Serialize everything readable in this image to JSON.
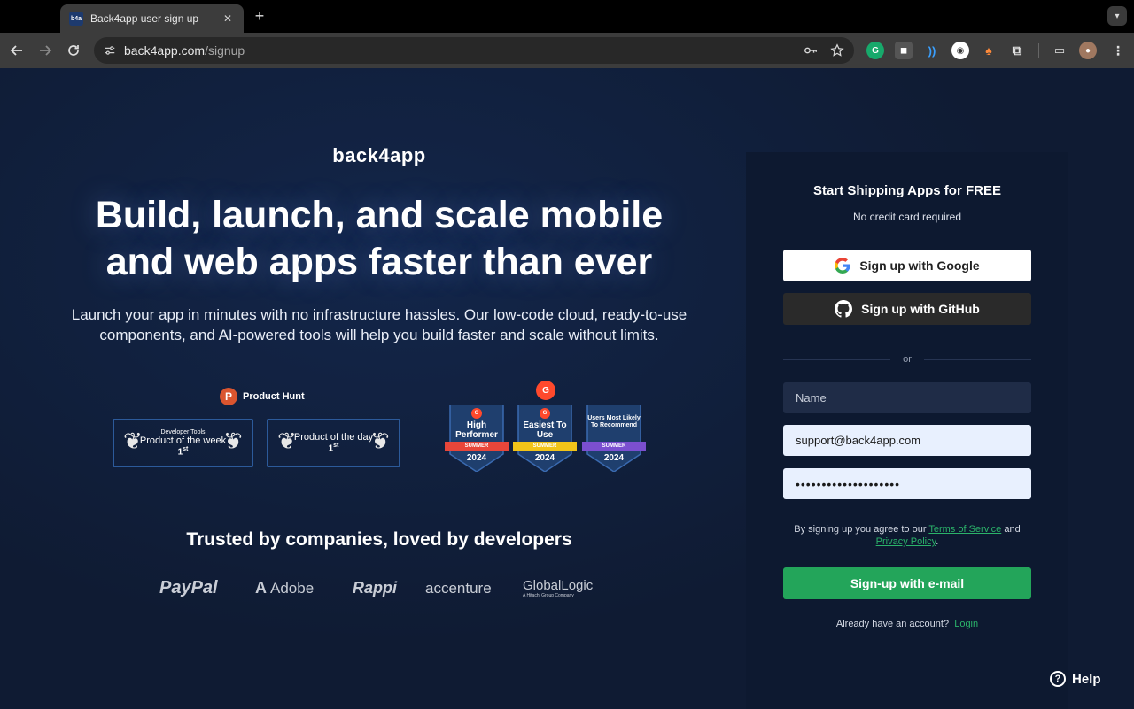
{
  "browser": {
    "tab_title": "Back4app user sign up",
    "tab_favicon_text": "b4a",
    "url_host": "back4app.com",
    "url_path": "/signup"
  },
  "hero": {
    "logo": "back4app",
    "headline_line1": "Build, launch, and scale mobile",
    "headline_line2": "and web apps faster than ever",
    "subtitle": "Launch your app in minutes with no infrastructure hassles. Our low-code cloud, ready-to-use components, and AI-powered tools will help you build faster and scale without limits."
  },
  "awards": {
    "producthunt_label": "Product Hunt",
    "producthunt_icon": "P",
    "week": {
      "category": "Developer Tools",
      "title": "Product of the week",
      "rank": "1",
      "rank_suffix": "st"
    },
    "day": {
      "title": "Product of the day",
      "rank": "1",
      "rank_suffix": "st"
    },
    "g2_icon": "G",
    "g2": [
      {
        "title": "High Performer",
        "season": "SUMMER",
        "year": "2024",
        "ribbon_color": "#e8463a"
      },
      {
        "title": "Easiest To Use",
        "season": "SUMMER",
        "year": "2024",
        "ribbon_color": "#f2c419"
      },
      {
        "title": "Users Most Likely To Recommend",
        "season": "SUMMER",
        "year": "2024",
        "ribbon_color": "#7b4fd0"
      }
    ]
  },
  "trusted": {
    "heading": "Trusted by companies, loved by developers",
    "brands": [
      "PayPal",
      "Adobe",
      "Rappi",
      "accenture",
      "GlobalLogic"
    ],
    "globallogic_sub": "A Hitachi Group Company"
  },
  "signup": {
    "title": "Start Shipping Apps for FREE",
    "subtitle": "No credit card required",
    "google_label": "Sign up with Google",
    "github_label": "Sign up with GitHub",
    "or_label": "or",
    "name_placeholder": "Name",
    "email_value": "support@back4app.com",
    "password_value": "••••••••••••••••••••",
    "terms_prefix": "By signing up you agree to our ",
    "terms_link": "Terms of Service",
    "terms_and": " and ",
    "privacy_link": "Privacy Policy",
    "terms_suffix": ".",
    "submit_label": "Sign-up with e-mail",
    "login_prompt": "Already have an account?",
    "login_link": "Login"
  },
  "help": {
    "label": "Help",
    "icon": "?"
  },
  "colors": {
    "accent_green": "#23a55a",
    "page_bg": "#0f1b33",
    "panel_bg": "#0d1930",
    "producthunt": "#da552f",
    "g2": "#ff492c"
  }
}
